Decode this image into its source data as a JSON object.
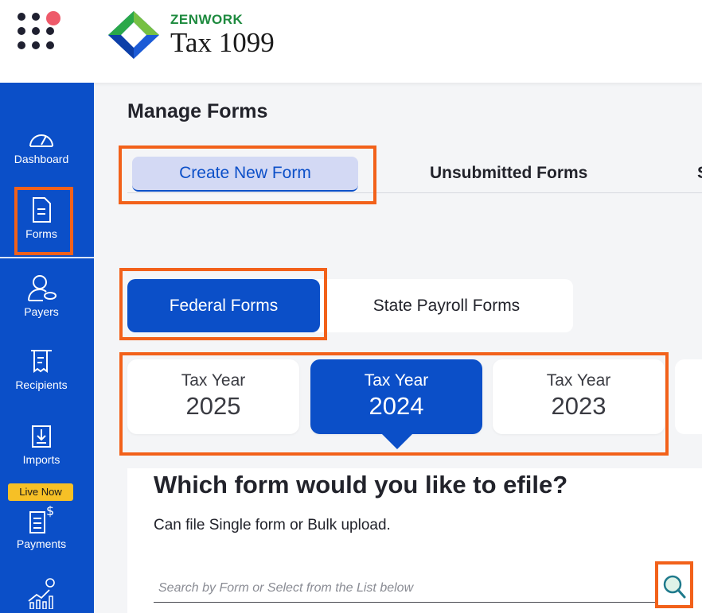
{
  "brand": {
    "company": "ZENWORK",
    "product": "Tax 1099"
  },
  "colors": {
    "primary": "#0b4fc8",
    "highlight": "#f2611a",
    "badge": "#f6c026",
    "brand_green": "#1d8a3e"
  },
  "sidebar": {
    "items": [
      {
        "label": "Dashboard",
        "icon": "gauge-icon"
      },
      {
        "label": "Forms",
        "icon": "document-icon"
      },
      {
        "label": "Payers",
        "icon": "payer-icon"
      },
      {
        "label": "Recipients",
        "icon": "receipt-icon"
      },
      {
        "label": "Imports",
        "icon": "download-icon"
      },
      {
        "label": "Payments",
        "icon": "invoice-dollar-icon"
      }
    ],
    "live_badge": "Live Now"
  },
  "main": {
    "page_title": "Manage Forms",
    "tabs": [
      "Create New Form",
      "Unsubmitted Forms",
      "S"
    ],
    "form_types": [
      "Federal Forms",
      "State Payroll Forms"
    ],
    "tax_years": [
      {
        "label": "Tax Year",
        "year": "2025"
      },
      {
        "label": "Tax Year",
        "year": "2024"
      },
      {
        "label": "Tax Year",
        "year": "2023"
      }
    ],
    "selected_year": "2024",
    "question": "Which form would you like to efile?",
    "subtitle": "Can file Single form or Bulk upload.",
    "search_placeholder": "Search by Form or Select from the List below"
  }
}
